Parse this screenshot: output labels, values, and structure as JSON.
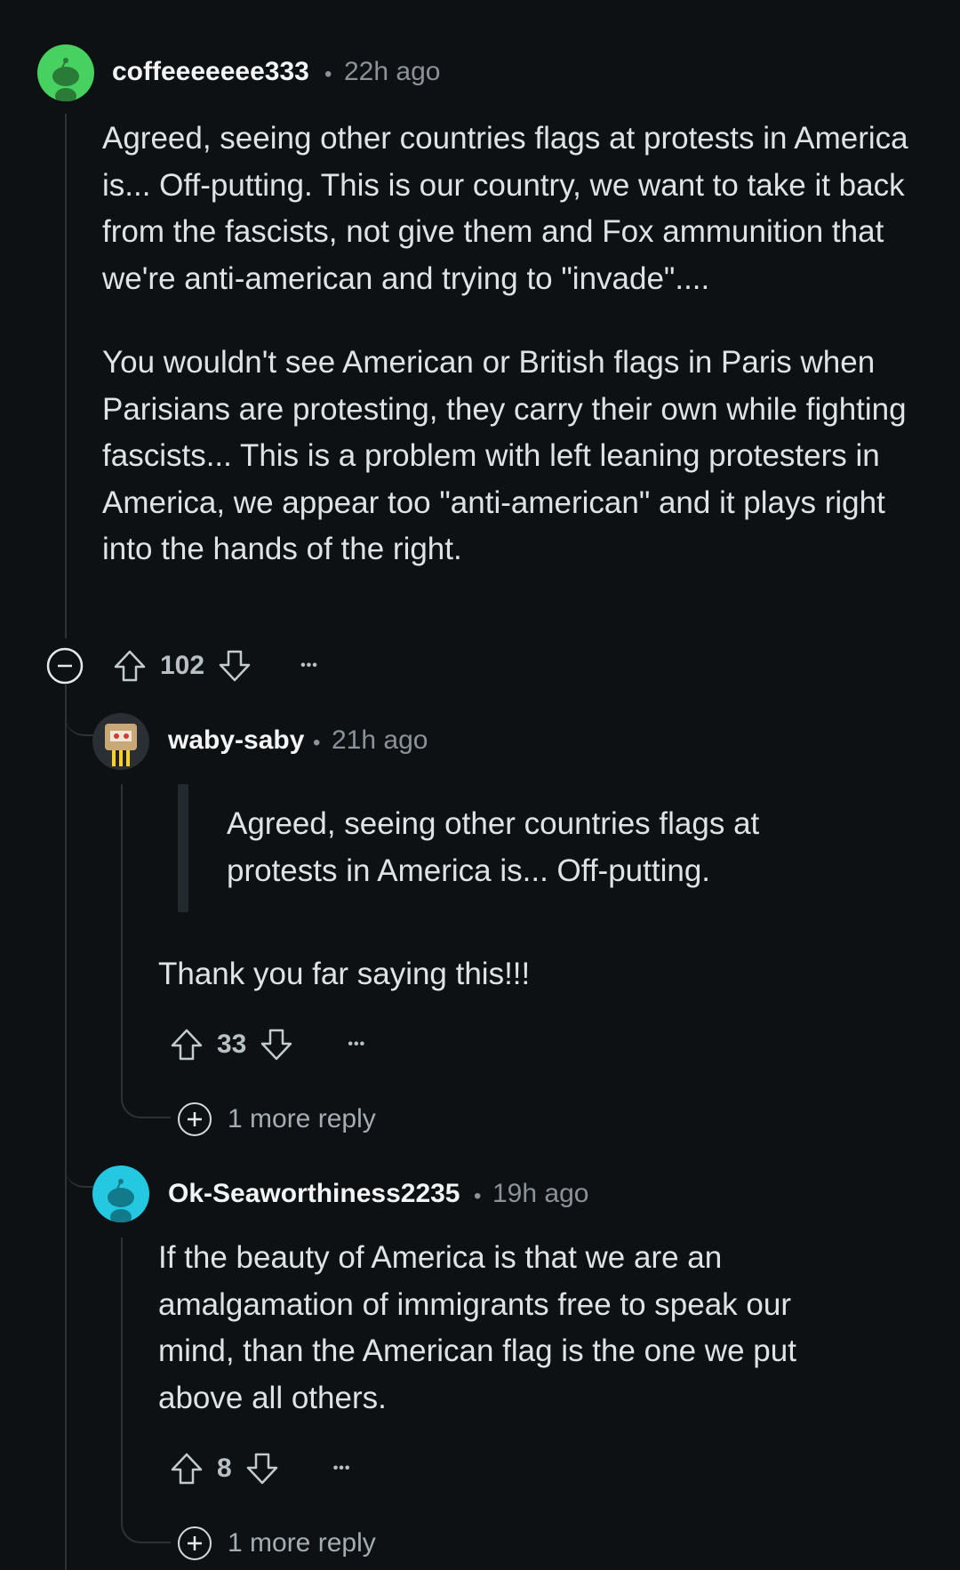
{
  "comments": [
    {
      "username": "coffeeeeeee333",
      "separator": "•",
      "time": "22h ago",
      "paragraphs": [
        "Agreed, seeing other countries flags at protests in America is... Off-putting. This is our country, we want to take it back from the fascists, not give them and Fox ammunition that we're anti-american and trying to \"invade\"....",
        "You wouldn't see American or British flags in Paris when Parisians are protesting, they carry their own while fighting fascists... This is a problem with left leaning protesters in America, we appear too \"anti-american\" and it plays right into the hands of the right."
      ],
      "score": "102",
      "more": "•••",
      "avatar_color": "#46d160"
    },
    {
      "username": "waby-saby",
      "separator": "•",
      "time": "21h ago",
      "quote": "Agreed, seeing other countries flags at protests in America is... Off-putting.",
      "paragraphs": [
        "Thank you far saying this!!!"
      ],
      "score": "33",
      "more": "•••",
      "more_replies": "1 more reply"
    },
    {
      "username": "Ok-Seaworthiness2235",
      "separator": "•",
      "time": "19h ago",
      "paragraphs": [
        "If the beauty of America is that we are an amalgamation of immigrants free to speak our mind, than the American flag is the one we put above all others."
      ],
      "score": "8",
      "more": "•••",
      "more_replies": "1 more reply",
      "avatar_color": "#24c8e0"
    }
  ],
  "icons": [
    "collapse-icon",
    "upvote-icon",
    "downvote-icon",
    "more-options-icon",
    "expand-replies-icon",
    "snoo-avatar-icon"
  ]
}
